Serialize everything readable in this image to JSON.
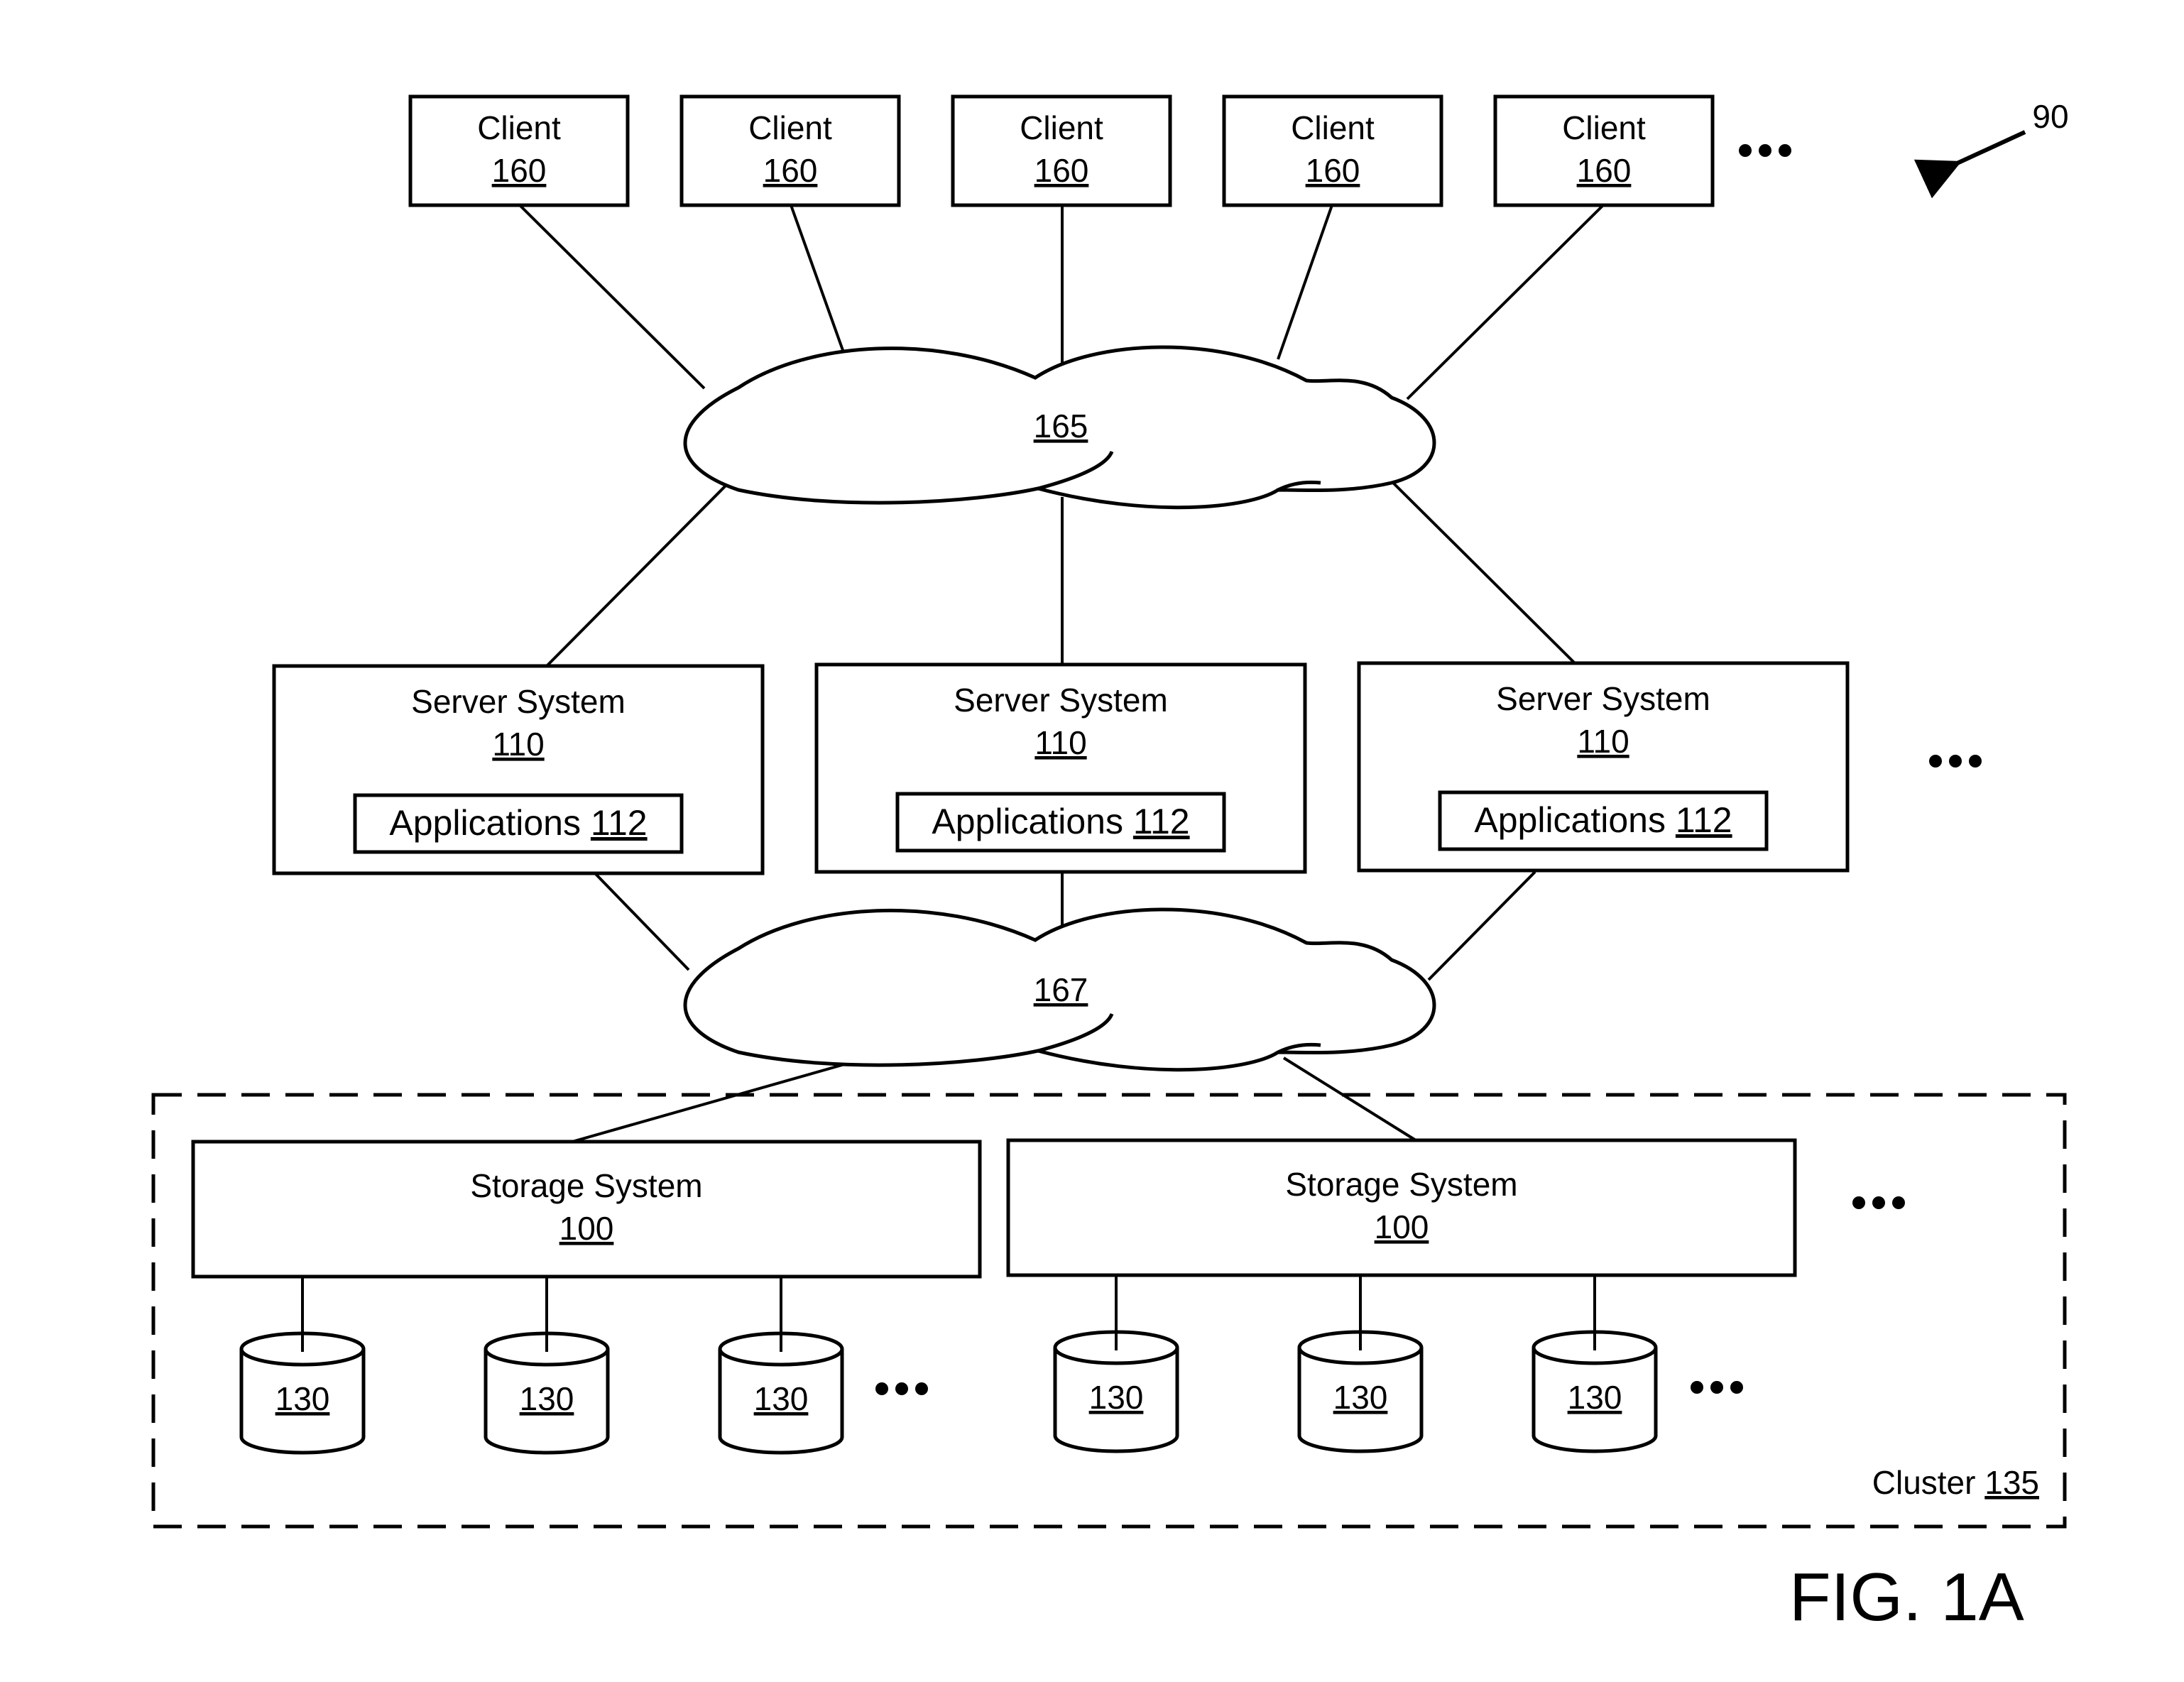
{
  "figure": {
    "label": "FIG. 1A",
    "system_ref": "90"
  },
  "clients": [
    {
      "name": "Client",
      "ref": "160"
    },
    {
      "name": "Client",
      "ref": "160"
    },
    {
      "name": "Client",
      "ref": "160"
    },
    {
      "name": "Client",
      "ref": "160"
    },
    {
      "name": "Client",
      "ref": "160"
    }
  ],
  "networks": {
    "upper": {
      "ref": "165"
    },
    "lower": {
      "ref": "167"
    }
  },
  "servers": [
    {
      "name": "Server System",
      "ref": "110",
      "app_name": "Applications",
      "app_ref": "112"
    },
    {
      "name": "Server System",
      "ref": "110",
      "app_name": "Applications",
      "app_ref": "112"
    },
    {
      "name": "Server System",
      "ref": "110",
      "app_name": "Applications",
      "app_ref": "112"
    }
  ],
  "cluster": {
    "name": "Cluster",
    "ref": "135",
    "storage_systems": [
      {
        "name": "Storage System",
        "ref": "100",
        "disks": [
          "130",
          "130",
          "130"
        ]
      },
      {
        "name": "Storage System",
        "ref": "100",
        "disks": [
          "130",
          "130",
          "130"
        ]
      }
    ]
  },
  "ellipsis_marker": "more-items"
}
